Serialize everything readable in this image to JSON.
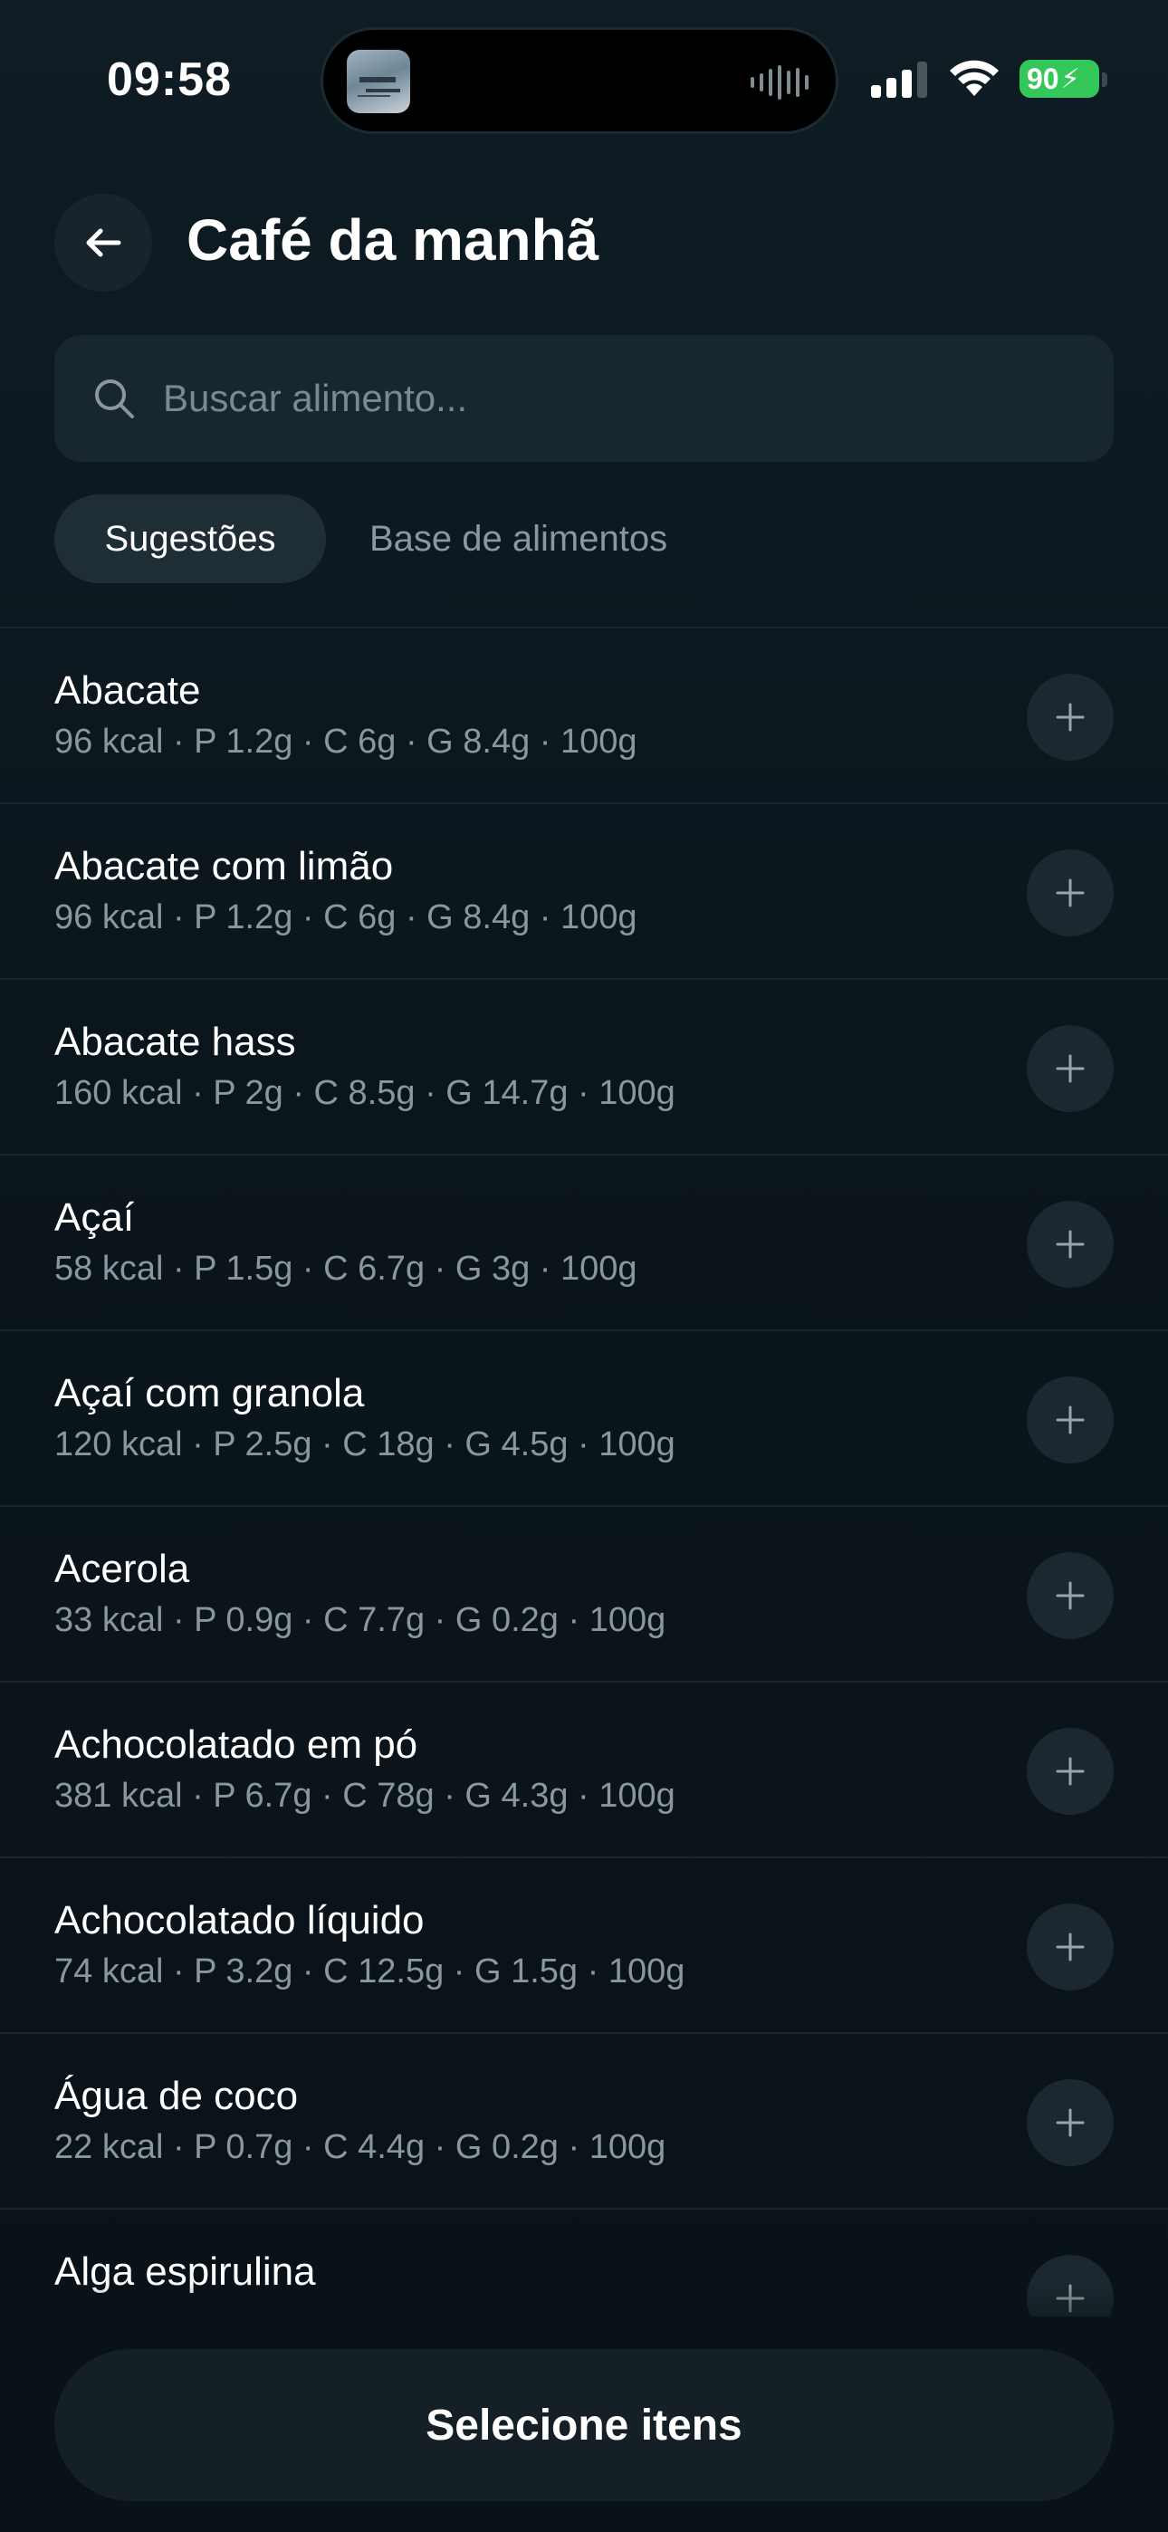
{
  "status_bar": {
    "time": "09:58",
    "battery": "90",
    "battery_color": "#34c759"
  },
  "header": {
    "title": "Café da manhã",
    "back_icon": "arrow-left-icon"
  },
  "search": {
    "placeholder": "Buscar alimento...",
    "value": "",
    "icon": "search-icon"
  },
  "tabs": [
    {
      "label": "Sugestões",
      "active": true
    },
    {
      "label": "Base de alimentos",
      "active": false
    }
  ],
  "foods": [
    {
      "name": "Abacate",
      "macros": "96 kcal · P 1.2g · C 6g · G 8.4g · 100g"
    },
    {
      "name": "Abacate com limão",
      "macros": "96 kcal · P 1.2g · C 6g · G 8.4g · 100g"
    },
    {
      "name": "Abacate hass",
      "macros": "160 kcal · P 2g · C 8.5g · G 14.7g · 100g"
    },
    {
      "name": "Açaí",
      "macros": "58 kcal · P 1.5g · C 6.7g · G 3g · 100g"
    },
    {
      "name": "Açaí com granola",
      "macros": "120 kcal · P 2.5g · C 18g · G 4.5g · 100g"
    },
    {
      "name": "Acerola",
      "macros": "33 kcal · P 0.9g · C 7.7g · G 0.2g · 100g"
    },
    {
      "name": "Achocolatado em pó",
      "macros": "381 kcal · P 6.7g · C 78g · G 4.3g · 100g"
    },
    {
      "name": "Achocolatado líquido",
      "macros": "74 kcal · P 3.2g · C 12.5g · G 1.5g · 100g"
    },
    {
      "name": "Água de coco",
      "macros": "22 kcal · P 0.7g · C 4.4g · G 0.2g · 100g"
    },
    {
      "name": "Alga espirulina",
      "macros": ""
    }
  ],
  "add_icon": "plus-icon",
  "footer": {
    "button_label": "Selecione itens"
  }
}
